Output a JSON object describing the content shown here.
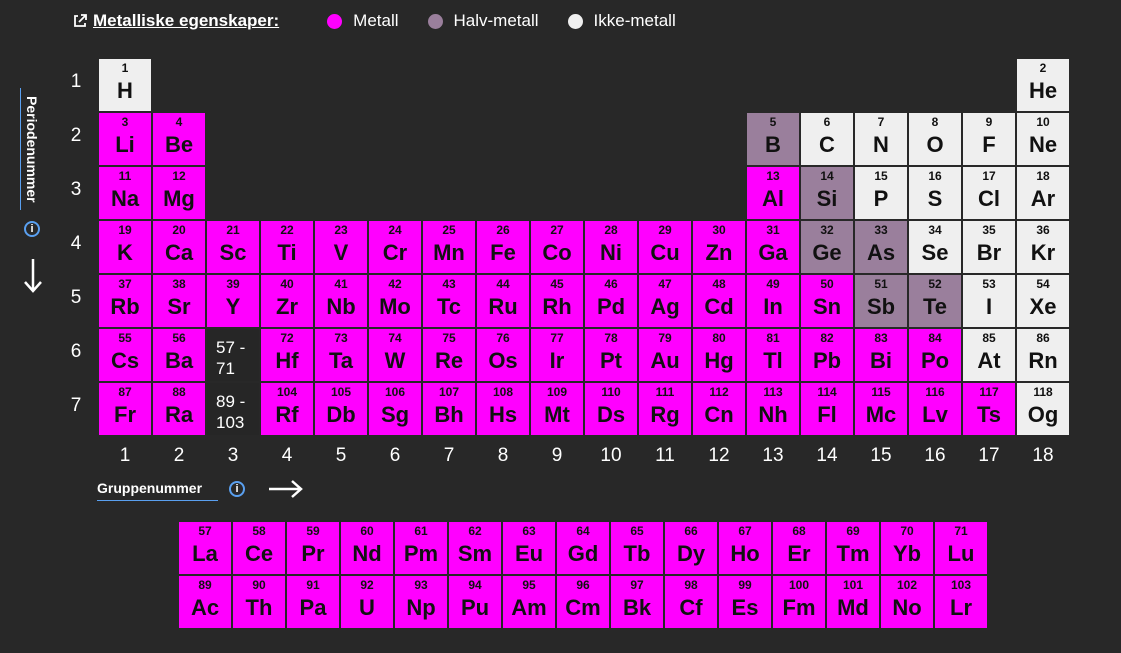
{
  "legend": {
    "property": "Metalliske egenskaper:",
    "items": [
      {
        "label": "Metall",
        "color": "#ff00ff"
      },
      {
        "label": "Halv-metall",
        "color": "#9a7f9c"
      },
      {
        "label": "Ikke-metall",
        "color": "#efefef"
      }
    ]
  },
  "axes": {
    "period_title": "Periodenummer",
    "group_title": "Gruppenummer",
    "periods": [
      "1",
      "2",
      "3",
      "4",
      "5",
      "6",
      "7"
    ],
    "groups": [
      "1",
      "2",
      "3",
      "4",
      "5",
      "6",
      "7",
      "8",
      "9",
      "10",
      "11",
      "12",
      "13",
      "14",
      "15",
      "16",
      "17",
      "18"
    ]
  },
  "colors": {
    "metal": "#ff00ff",
    "semimetal": "#9a7f9c",
    "nonmetal": "#efefef",
    "background": "#282828"
  },
  "placeholders": {
    "lanthanides": "57 - 71",
    "actinides": "89 - 103"
  },
  "elements": [
    {
      "n": 1,
      "s": "H",
      "p": 1,
      "g": 1,
      "t": "non"
    },
    {
      "n": 2,
      "s": "He",
      "p": 1,
      "g": 18,
      "t": "non"
    },
    {
      "n": 3,
      "s": "Li",
      "p": 2,
      "g": 1,
      "t": "metal"
    },
    {
      "n": 4,
      "s": "Be",
      "p": 2,
      "g": 2,
      "t": "metal"
    },
    {
      "n": 5,
      "s": "B",
      "p": 2,
      "g": 13,
      "t": "semi"
    },
    {
      "n": 6,
      "s": "C",
      "p": 2,
      "g": 14,
      "t": "non"
    },
    {
      "n": 7,
      "s": "N",
      "p": 2,
      "g": 15,
      "t": "non"
    },
    {
      "n": 8,
      "s": "O",
      "p": 2,
      "g": 16,
      "t": "non"
    },
    {
      "n": 9,
      "s": "F",
      "p": 2,
      "g": 17,
      "t": "non"
    },
    {
      "n": 10,
      "s": "Ne",
      "p": 2,
      "g": 18,
      "t": "non"
    },
    {
      "n": 11,
      "s": "Na",
      "p": 3,
      "g": 1,
      "t": "metal"
    },
    {
      "n": 12,
      "s": "Mg",
      "p": 3,
      "g": 2,
      "t": "metal"
    },
    {
      "n": 13,
      "s": "Al",
      "p": 3,
      "g": 13,
      "t": "metal"
    },
    {
      "n": 14,
      "s": "Si",
      "p": 3,
      "g": 14,
      "t": "semi"
    },
    {
      "n": 15,
      "s": "P",
      "p": 3,
      "g": 15,
      "t": "non"
    },
    {
      "n": 16,
      "s": "S",
      "p": 3,
      "g": 16,
      "t": "non"
    },
    {
      "n": 17,
      "s": "Cl",
      "p": 3,
      "g": 17,
      "t": "non"
    },
    {
      "n": 18,
      "s": "Ar",
      "p": 3,
      "g": 18,
      "t": "non"
    },
    {
      "n": 19,
      "s": "K",
      "p": 4,
      "g": 1,
      "t": "metal"
    },
    {
      "n": 20,
      "s": "Ca",
      "p": 4,
      "g": 2,
      "t": "metal"
    },
    {
      "n": 21,
      "s": "Sc",
      "p": 4,
      "g": 3,
      "t": "metal"
    },
    {
      "n": 22,
      "s": "Ti",
      "p": 4,
      "g": 4,
      "t": "metal"
    },
    {
      "n": 23,
      "s": "V",
      "p": 4,
      "g": 5,
      "t": "metal"
    },
    {
      "n": 24,
      "s": "Cr",
      "p": 4,
      "g": 6,
      "t": "metal"
    },
    {
      "n": 25,
      "s": "Mn",
      "p": 4,
      "g": 7,
      "t": "metal"
    },
    {
      "n": 26,
      "s": "Fe",
      "p": 4,
      "g": 8,
      "t": "metal"
    },
    {
      "n": 27,
      "s": "Co",
      "p": 4,
      "g": 9,
      "t": "metal"
    },
    {
      "n": 28,
      "s": "Ni",
      "p": 4,
      "g": 10,
      "t": "metal"
    },
    {
      "n": 29,
      "s": "Cu",
      "p": 4,
      "g": 11,
      "t": "metal"
    },
    {
      "n": 30,
      "s": "Zn",
      "p": 4,
      "g": 12,
      "t": "metal"
    },
    {
      "n": 31,
      "s": "Ga",
      "p": 4,
      "g": 13,
      "t": "metal"
    },
    {
      "n": 32,
      "s": "Ge",
      "p": 4,
      "g": 14,
      "t": "semi"
    },
    {
      "n": 33,
      "s": "As",
      "p": 4,
      "g": 15,
      "t": "semi"
    },
    {
      "n": 34,
      "s": "Se",
      "p": 4,
      "g": 16,
      "t": "non"
    },
    {
      "n": 35,
      "s": "Br",
      "p": 4,
      "g": 17,
      "t": "non"
    },
    {
      "n": 36,
      "s": "Kr",
      "p": 4,
      "g": 18,
      "t": "non"
    },
    {
      "n": 37,
      "s": "Rb",
      "p": 5,
      "g": 1,
      "t": "metal"
    },
    {
      "n": 38,
      "s": "Sr",
      "p": 5,
      "g": 2,
      "t": "metal"
    },
    {
      "n": 39,
      "s": "Y",
      "p": 5,
      "g": 3,
      "t": "metal"
    },
    {
      "n": 40,
      "s": "Zr",
      "p": 5,
      "g": 4,
      "t": "metal"
    },
    {
      "n": 41,
      "s": "Nb",
      "p": 5,
      "g": 5,
      "t": "metal"
    },
    {
      "n": 42,
      "s": "Mo",
      "p": 5,
      "g": 6,
      "t": "metal"
    },
    {
      "n": 43,
      "s": "Tc",
      "p": 5,
      "g": 7,
      "t": "metal"
    },
    {
      "n": 44,
      "s": "Ru",
      "p": 5,
      "g": 8,
      "t": "metal"
    },
    {
      "n": 45,
      "s": "Rh",
      "p": 5,
      "g": 9,
      "t": "metal"
    },
    {
      "n": 46,
      "s": "Pd",
      "p": 5,
      "g": 10,
      "t": "metal"
    },
    {
      "n": 47,
      "s": "Ag",
      "p": 5,
      "g": 11,
      "t": "metal"
    },
    {
      "n": 48,
      "s": "Cd",
      "p": 5,
      "g": 12,
      "t": "metal"
    },
    {
      "n": 49,
      "s": "In",
      "p": 5,
      "g": 13,
      "t": "metal"
    },
    {
      "n": 50,
      "s": "Sn",
      "p": 5,
      "g": 14,
      "t": "metal"
    },
    {
      "n": 51,
      "s": "Sb",
      "p": 5,
      "g": 15,
      "t": "semi"
    },
    {
      "n": 52,
      "s": "Te",
      "p": 5,
      "g": 16,
      "t": "semi"
    },
    {
      "n": 53,
      "s": "I",
      "p": 5,
      "g": 17,
      "t": "non"
    },
    {
      "n": 54,
      "s": "Xe",
      "p": 5,
      "g": 18,
      "t": "non"
    },
    {
      "n": 55,
      "s": "Cs",
      "p": 6,
      "g": 1,
      "t": "metal"
    },
    {
      "n": 56,
      "s": "Ba",
      "p": 6,
      "g": 2,
      "t": "metal"
    },
    {
      "n": 72,
      "s": "Hf",
      "p": 6,
      "g": 4,
      "t": "metal"
    },
    {
      "n": 73,
      "s": "Ta",
      "p": 6,
      "g": 5,
      "t": "metal"
    },
    {
      "n": 74,
      "s": "W",
      "p": 6,
      "g": 6,
      "t": "metal"
    },
    {
      "n": 75,
      "s": "Re",
      "p": 6,
      "g": 7,
      "t": "metal"
    },
    {
      "n": 76,
      "s": "Os",
      "p": 6,
      "g": 8,
      "t": "metal"
    },
    {
      "n": 77,
      "s": "Ir",
      "p": 6,
      "g": 9,
      "t": "metal"
    },
    {
      "n": 78,
      "s": "Pt",
      "p": 6,
      "g": 10,
      "t": "metal"
    },
    {
      "n": 79,
      "s": "Au",
      "p": 6,
      "g": 11,
      "t": "metal"
    },
    {
      "n": 80,
      "s": "Hg",
      "p": 6,
      "g": 12,
      "t": "metal"
    },
    {
      "n": 81,
      "s": "Tl",
      "p": 6,
      "g": 13,
      "t": "metal"
    },
    {
      "n": 82,
      "s": "Pb",
      "p": 6,
      "g": 14,
      "t": "metal"
    },
    {
      "n": 83,
      "s": "Bi",
      "p": 6,
      "g": 15,
      "t": "metal"
    },
    {
      "n": 84,
      "s": "Po",
      "p": 6,
      "g": 16,
      "t": "metal"
    },
    {
      "n": 85,
      "s": "At",
      "p": 6,
      "g": 17,
      "t": "non"
    },
    {
      "n": 86,
      "s": "Rn",
      "p": 6,
      "g": 18,
      "t": "non"
    },
    {
      "n": 87,
      "s": "Fr",
      "p": 7,
      "g": 1,
      "t": "metal"
    },
    {
      "n": 88,
      "s": "Ra",
      "p": 7,
      "g": 2,
      "t": "metal"
    },
    {
      "n": 104,
      "s": "Rf",
      "p": 7,
      "g": 4,
      "t": "metal"
    },
    {
      "n": 105,
      "s": "Db",
      "p": 7,
      "g": 5,
      "t": "metal"
    },
    {
      "n": 106,
      "s": "Sg",
      "p": 7,
      "g": 6,
      "t": "metal"
    },
    {
      "n": 107,
      "s": "Bh",
      "p": 7,
      "g": 7,
      "t": "metal"
    },
    {
      "n": 108,
      "s": "Hs",
      "p": 7,
      "g": 8,
      "t": "metal"
    },
    {
      "n": 109,
      "s": "Mt",
      "p": 7,
      "g": 9,
      "t": "metal"
    },
    {
      "n": 110,
      "s": "Ds",
      "p": 7,
      "g": 10,
      "t": "metal"
    },
    {
      "n": 111,
      "s": "Rg",
      "p": 7,
      "g": 11,
      "t": "metal"
    },
    {
      "n": 112,
      "s": "Cn",
      "p": 7,
      "g": 12,
      "t": "metal"
    },
    {
      "n": 113,
      "s": "Nh",
      "p": 7,
      "g": 13,
      "t": "metal"
    },
    {
      "n": 114,
      "s": "Fl",
      "p": 7,
      "g": 14,
      "t": "metal"
    },
    {
      "n": 115,
      "s": "Mc",
      "p": 7,
      "g": 15,
      "t": "metal"
    },
    {
      "n": 116,
      "s": "Lv",
      "p": 7,
      "g": 16,
      "t": "metal"
    },
    {
      "n": 117,
      "s": "Ts",
      "p": 7,
      "g": 17,
      "t": "metal"
    },
    {
      "n": 118,
      "s": "Og",
      "p": 7,
      "g": 18,
      "t": "non"
    }
  ],
  "lanthanides": [
    {
      "n": 57,
      "s": "La",
      "t": "metal"
    },
    {
      "n": 58,
      "s": "Ce",
      "t": "metal"
    },
    {
      "n": 59,
      "s": "Pr",
      "t": "metal"
    },
    {
      "n": 60,
      "s": "Nd",
      "t": "metal"
    },
    {
      "n": 61,
      "s": "Pm",
      "t": "metal"
    },
    {
      "n": 62,
      "s": "Sm",
      "t": "metal"
    },
    {
      "n": 63,
      "s": "Eu",
      "t": "metal"
    },
    {
      "n": 64,
      "s": "Gd",
      "t": "metal"
    },
    {
      "n": 65,
      "s": "Tb",
      "t": "metal"
    },
    {
      "n": 66,
      "s": "Dy",
      "t": "metal"
    },
    {
      "n": 67,
      "s": "Ho",
      "t": "metal"
    },
    {
      "n": 68,
      "s": "Er",
      "t": "metal"
    },
    {
      "n": 69,
      "s": "Tm",
      "t": "metal"
    },
    {
      "n": 70,
      "s": "Yb",
      "t": "metal"
    },
    {
      "n": 71,
      "s": "Lu",
      "t": "metal"
    }
  ],
  "actinides": [
    {
      "n": 89,
      "s": "Ac",
      "t": "metal"
    },
    {
      "n": 90,
      "s": "Th",
      "t": "metal"
    },
    {
      "n": 91,
      "s": "Pa",
      "t": "metal"
    },
    {
      "n": 92,
      "s": "U",
      "t": "metal"
    },
    {
      "n": 93,
      "s": "Np",
      "t": "metal"
    },
    {
      "n": 94,
      "s": "Pu",
      "t": "metal"
    },
    {
      "n": 95,
      "s": "Am",
      "t": "metal"
    },
    {
      "n": 96,
      "s": "Cm",
      "t": "metal"
    },
    {
      "n": 97,
      "s": "Bk",
      "t": "metal"
    },
    {
      "n": 98,
      "s": "Cf",
      "t": "metal"
    },
    {
      "n": 99,
      "s": "Es",
      "t": "metal"
    },
    {
      "n": 100,
      "s": "Fm",
      "t": "metal"
    },
    {
      "n": 101,
      "s": "Md",
      "t": "metal"
    },
    {
      "n": 102,
      "s": "No",
      "t": "metal"
    },
    {
      "n": 103,
      "s": "Lr",
      "t": "metal"
    }
  ]
}
